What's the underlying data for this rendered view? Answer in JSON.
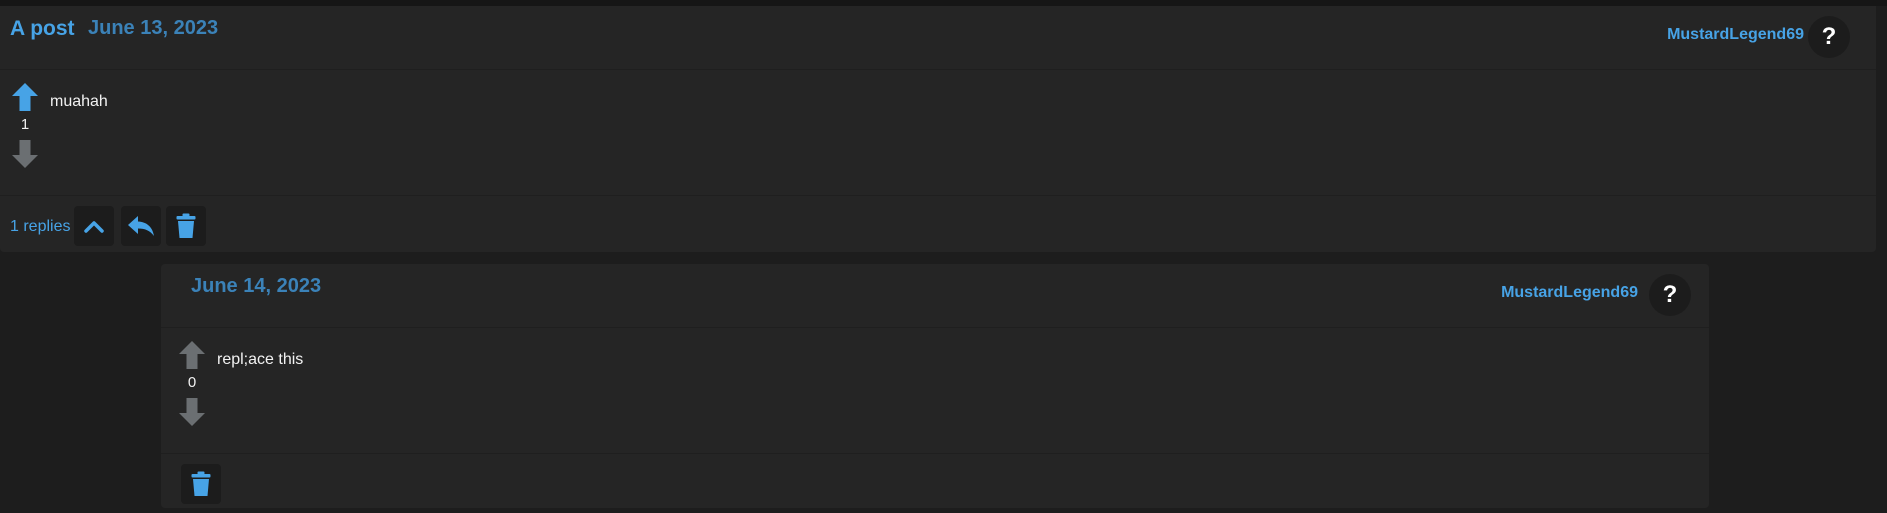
{
  "post": {
    "title": "A post",
    "date": "June 13, 2023",
    "username": "MustardLegend69",
    "help_glyph": "?",
    "score": "1",
    "content": "muahah",
    "replies_text": "1 replies",
    "upvote_active": true
  },
  "reply": {
    "date": "June 14, 2023",
    "username": "MustardLegend69",
    "help_glyph": "?",
    "score": "0",
    "content": "repl;ace this"
  },
  "colors": {
    "background": "#1d1d1d",
    "card": "#252525",
    "accent": "#47a3e6",
    "date": "#3b82b8",
    "arrow_inactive": "#6b6f72",
    "text": "#f2f2f2"
  },
  "icons": {
    "upvote": "arrow-up-icon",
    "downvote": "arrow-down-icon",
    "collapse": "chevron-up-icon",
    "reply": "reply-icon",
    "delete": "trash-icon",
    "help": "question-icon"
  }
}
